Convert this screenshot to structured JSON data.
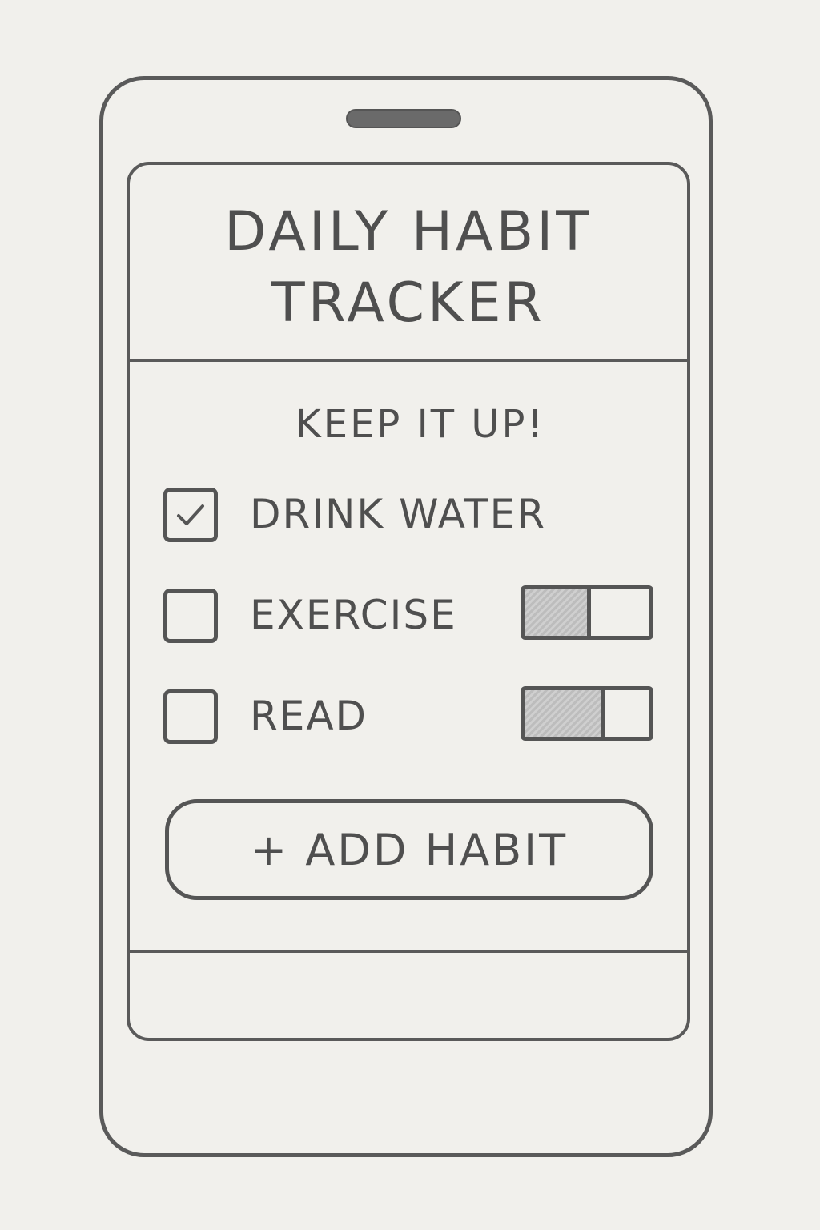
{
  "header": {
    "title_line1": "DAILY HABIT",
    "title_line2": "TRACKER"
  },
  "main": {
    "motivation": "KEEP IT UP!",
    "habits": [
      {
        "label": "DRINK WATER",
        "checked": true
      },
      {
        "label": "EXERCISE",
        "checked": false,
        "progress": 0.53
      },
      {
        "label": "READ",
        "checked": false,
        "progress": 0.65
      }
    ],
    "add_button_label": "+ ADD HABIT"
  },
  "icons": {
    "checkmark": "checkmark-icon",
    "speaker": "speaker-icon"
  },
  "colors": {
    "stroke": "#5a5a5a",
    "paper": "#f1f0ec",
    "fill": "#c4c4c4"
  }
}
